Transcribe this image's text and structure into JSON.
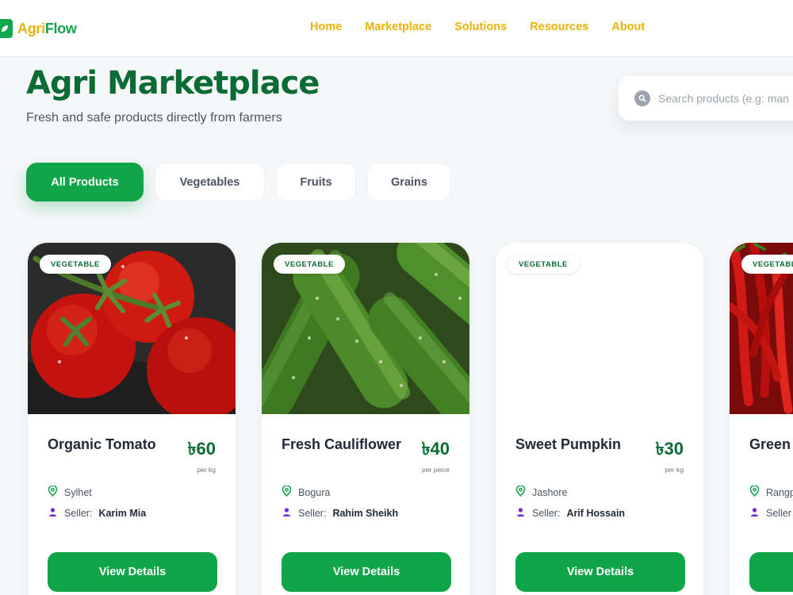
{
  "brand": {
    "part1": "Agri",
    "part2": "Flow"
  },
  "nav": [
    "Home",
    "Marketplace",
    "Solutions",
    "Resources",
    "About"
  ],
  "hero": {
    "title": "Agri Marketplace",
    "subtitle": "Fresh and safe products directly from farmers"
  },
  "search": {
    "placeholder": "Search products (e.g: man"
  },
  "filters": [
    "All Products",
    "Vegetables",
    "Fruits",
    "Grains"
  ],
  "active_filter": "All Products",
  "products": [
    {
      "badge": "VEGETABLE",
      "name": "Organic Tomato",
      "price": "৳60",
      "unit": "per kg",
      "location": "Sylhet",
      "seller_label": "Seller:",
      "seller": "Karim Mia",
      "button": "View Details",
      "image": "tomato"
    },
    {
      "badge": "VEGETABLE",
      "name": "Fresh Cauliflower",
      "price": "৳40",
      "unit": "per piece",
      "location": "Bogura",
      "seller_label": "Seller:",
      "seller": "Rahim Sheikh",
      "button": "View Details",
      "image": "cucumber"
    },
    {
      "badge": "VEGETABLE",
      "name": "Sweet Pumpkin",
      "price": "৳30",
      "unit": "per kg",
      "location": "Jashore",
      "seller_label": "Seller:",
      "seller": "Arif Hossain",
      "button": "View Details",
      "image": "none"
    },
    {
      "badge": "VEGETABL",
      "name": "Green",
      "price": "",
      "unit": "",
      "location": "Rangp",
      "seller_label": "Seller",
      "seller": "",
      "button": "",
      "image": "chili"
    }
  ],
  "colors": {
    "brand_green": "#0fa548",
    "dark_green": "#0b6b35",
    "nav_yellow": "#eab308",
    "background": "#f5f7f9"
  },
  "icons": {
    "search": "search-icon",
    "location": "location-pin-icon",
    "seller": "user-icon"
  }
}
